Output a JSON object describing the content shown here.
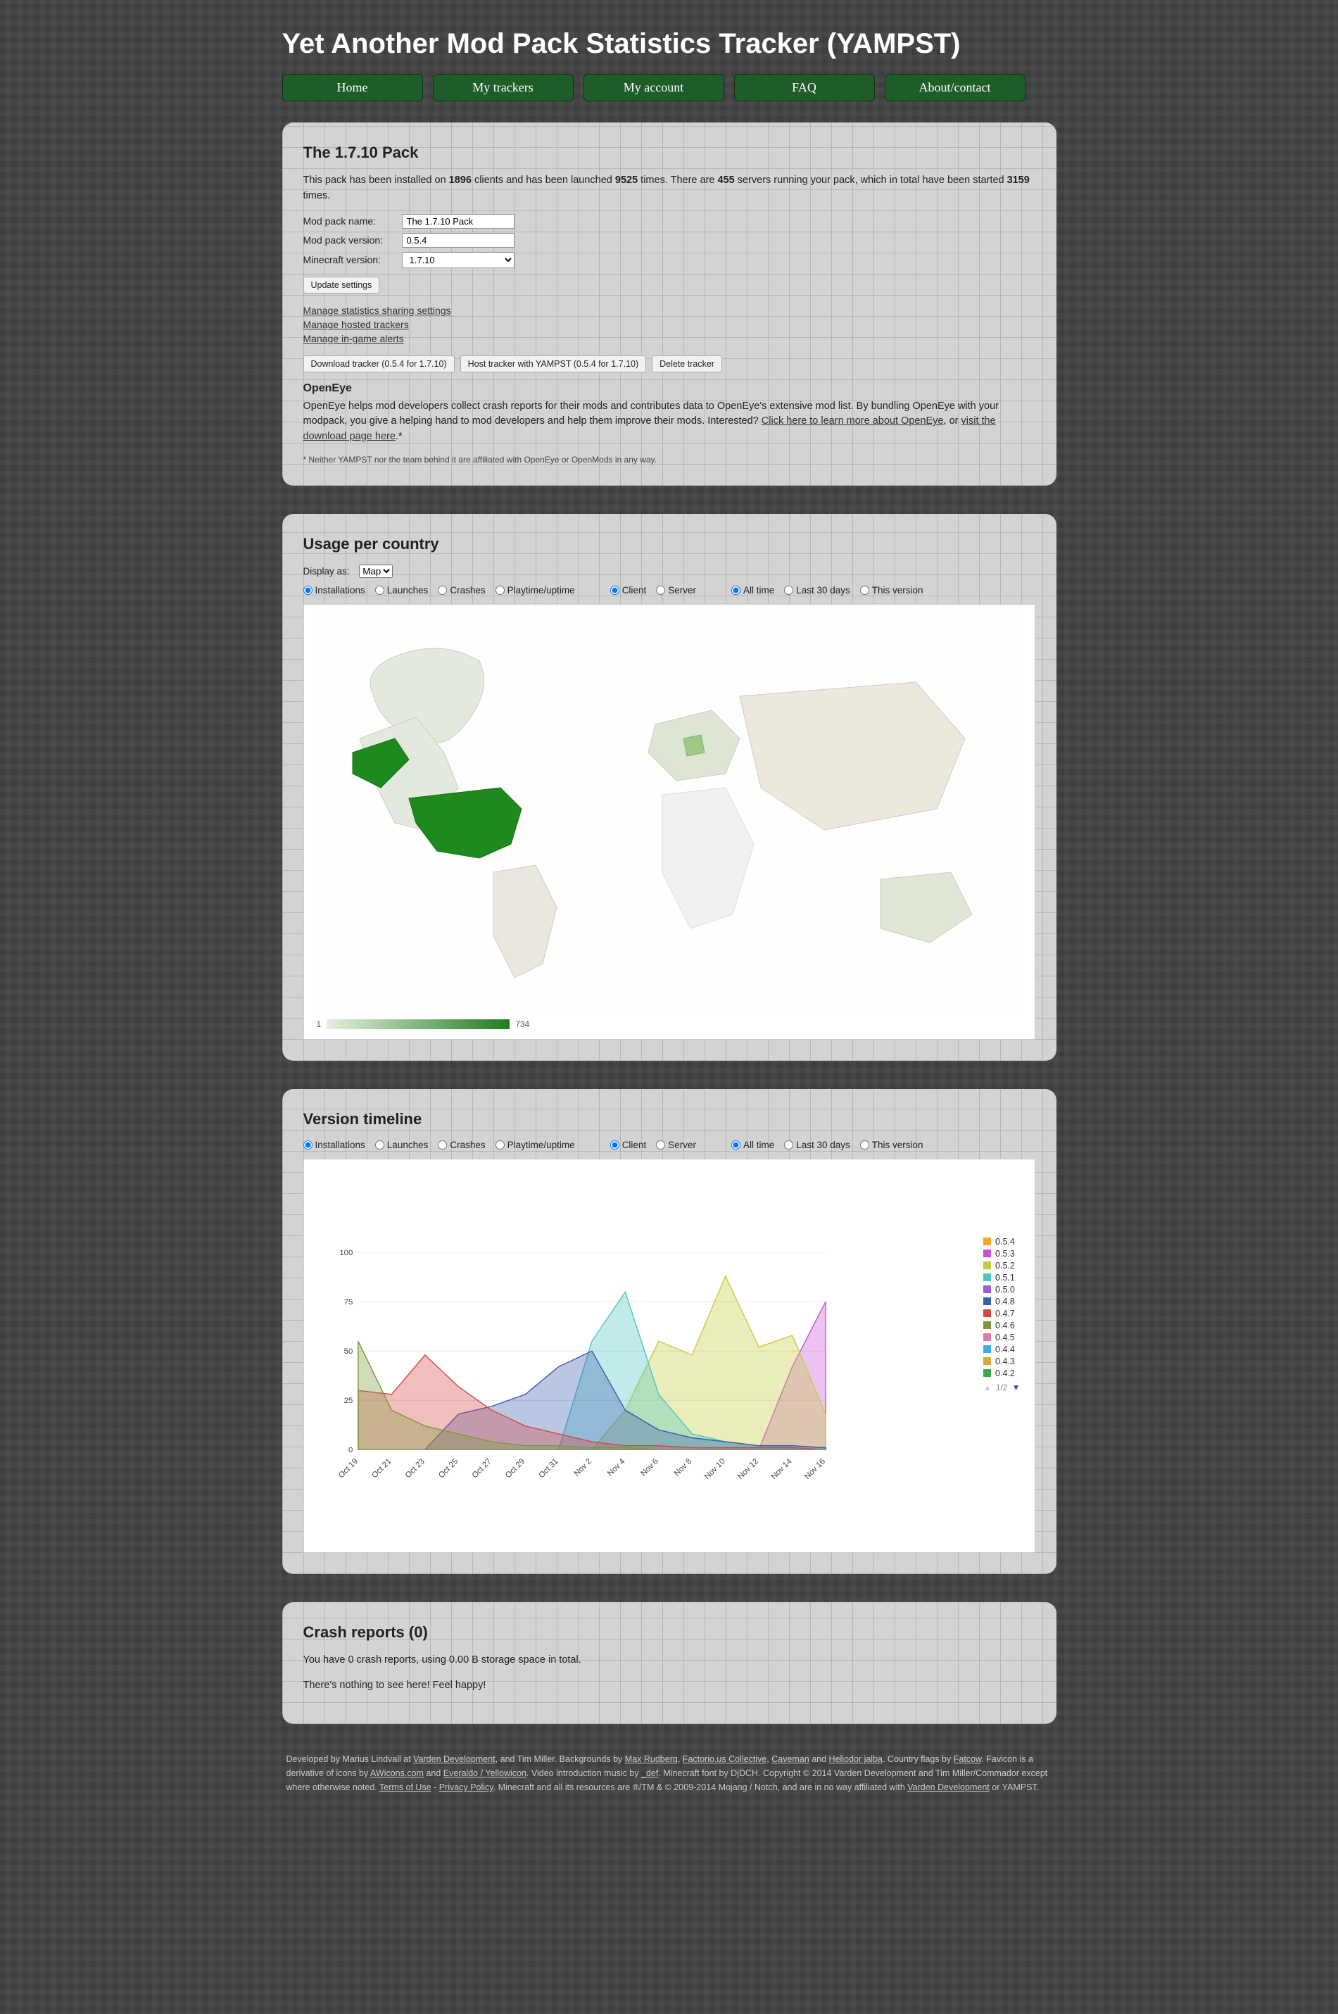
{
  "page_title": "Yet Another Mod Pack Statistics Tracker (YAMPST)",
  "nav": [
    "Home",
    "My trackers",
    "My account",
    "FAQ",
    "About/contact"
  ],
  "pack": {
    "title": "The 1.7.10 Pack",
    "stats": {
      "installs": "1896",
      "launches": "9525",
      "servers": "455",
      "server_starts": "3159"
    },
    "form": {
      "name_label": "Mod pack name:",
      "name_value": "The 1.7.10 Pack",
      "ver_label": "Mod pack version:",
      "ver_value": "0.5.4",
      "mc_label": "Minecraft version:",
      "mc_value": "1.7.10",
      "update_btn": "Update settings"
    },
    "links": {
      "share": "Manage statistics sharing settings",
      "hosted": "Manage hosted trackers",
      "alerts": "Manage in-game alerts"
    },
    "btns": {
      "download": "Download tracker (0.5.4 for 1.7.10)",
      "host": "Host tracker with YAMPST (0.5.4 for 1.7.10)",
      "delete": "Delete tracker"
    },
    "openeye": {
      "heading": "OpenEye",
      "text": "OpenEye helps mod developers collect crash reports for their mods and contributes data to OpenEye's extensive mod list. By bundling OpenEye with your modpack, you give a helping hand to mod developers and help them improve their mods. Interested? ",
      "link1": "Click here to learn more about OpenEye",
      "mid": ", or ",
      "link2": "visit the download page here",
      "end": ".*",
      "disclaimer": "* Neither YAMPST nor the team behind it are affiliated with OpenEye or OpenMods in any way."
    }
  },
  "usage": {
    "title": "Usage per country",
    "display_label": "Display as:",
    "display_value": "Map",
    "metric_opts": [
      "Installations",
      "Launches",
      "Crashes",
      "Playtime/uptime"
    ],
    "side_opts": [
      "Client",
      "Server"
    ],
    "time_opts": [
      "All time",
      "Last 30 days",
      "This version"
    ],
    "legend_min": "1",
    "legend_max": "734"
  },
  "timeline": {
    "title": "Version timeline",
    "metric_opts": [
      "Installations",
      "Launches",
      "Crashes",
      "Playtime/uptime"
    ],
    "side_opts": [
      "Client",
      "Server"
    ],
    "time_opts": [
      "All time",
      "Last 30 days",
      "This version"
    ],
    "pager": "1/2",
    "legend": [
      {
        "label": "0.5.4",
        "color": "#f5a623"
      },
      {
        "label": "0.5.3",
        "color": "#c94fd8"
      },
      {
        "label": "0.5.2",
        "color": "#c7cc3d"
      },
      {
        "label": "0.5.1",
        "color": "#4ec7c2"
      },
      {
        "label": "0.5.0",
        "color": "#a05cd8"
      },
      {
        "label": "0.4.8",
        "color": "#3d5db0"
      },
      {
        "label": "0.4.7",
        "color": "#d84545"
      },
      {
        "label": "0.4.6",
        "color": "#7a9a3a"
      },
      {
        "label": "0.4.5",
        "color": "#e07aa8"
      },
      {
        "label": "0.4.4",
        "color": "#3daee0"
      },
      {
        "label": "0.4.3",
        "color": "#d8a83a"
      },
      {
        "label": "0.4.2",
        "color": "#3aa845"
      }
    ]
  },
  "crash": {
    "title": "Crash reports (0)",
    "line1": "You have 0 crash reports, using 0.00 B storage space in total.",
    "line2": "There's nothing to see here! Feel happy!"
  },
  "footer": {
    "t1": "Developed by Marius Lindvall at ",
    "l1": "Varden Development",
    "t2": ", and Tim Miller. Backgrounds by ",
    "l2": "Max Rudberg",
    "t3": ", ",
    "l3": "Factorio.us Collective",
    "t4": ", ",
    "l4": "Caveman",
    "t5": " and ",
    "l5": "Heliodor jalba",
    "t6": ". Country flags by ",
    "l6": "Fatcow",
    "t7": ". Favicon is a derivative of icons by ",
    "l7": "AWicons.com",
    "t8": " and ",
    "l8": "Everaldo / Yellowicon",
    "t9": ". Video introduction music by ",
    "l9": "_def",
    "t10": ". Minecraft font by DjDCH. Copyright © 2014 Varden Development and Tim Miller/Commador except where otherwise noted. ",
    "l10": "Terms of Use",
    "t11": " - ",
    "l11": "Privacy Policy",
    "t12": ". Minecraft and all its resources are ®/TM & © 2009-2014 Mojang / Notch, and are in no way affiliated with ",
    "l12": "Varden Development",
    "t13": " or YAMPST."
  },
  "chart_data": {
    "type": "area",
    "title": "Version timeline",
    "xlabel": "",
    "ylabel": "",
    "y_ticks": [
      0,
      25,
      50,
      75,
      100
    ],
    "ylim": [
      0,
      105
    ],
    "x": [
      "Oct 19",
      "Oct 21",
      "Oct 23",
      "Oct 25",
      "Oct 27",
      "Oct 29",
      "Oct 31",
      "Nov 2",
      "Nov 4",
      "Nov 6",
      "Nov 8",
      "Nov 10",
      "Nov 12",
      "Nov 14",
      "Nov 16"
    ],
    "series": [
      {
        "name": "0.5.4",
        "color": "#f5a623",
        "values": [
          0,
          0,
          0,
          0,
          0,
          0,
          0,
          0,
          0,
          0,
          0,
          0,
          0,
          0,
          0
        ]
      },
      {
        "name": "0.5.3",
        "color": "#c94fd8",
        "values": [
          0,
          0,
          0,
          0,
          0,
          0,
          0,
          0,
          0,
          0,
          0,
          0,
          0,
          42,
          75
        ]
      },
      {
        "name": "0.5.2",
        "color": "#c7cc3d",
        "values": [
          0,
          0,
          0,
          0,
          0,
          0,
          0,
          0,
          20,
          55,
          48,
          88,
          52,
          58,
          18
        ]
      },
      {
        "name": "0.5.1",
        "color": "#4ec7c2",
        "values": [
          0,
          0,
          0,
          0,
          0,
          0,
          0,
          55,
          80,
          28,
          8,
          4,
          2,
          2,
          1
        ]
      },
      {
        "name": "0.5.0",
        "color": "#a05cd8",
        "values": [
          0,
          0,
          0,
          0,
          0,
          0,
          0,
          0,
          0,
          0,
          0,
          0,
          0,
          0,
          0
        ]
      },
      {
        "name": "0.4.8",
        "color": "#3d5db0",
        "values": [
          0,
          0,
          0,
          18,
          22,
          28,
          42,
          50,
          20,
          10,
          6,
          4,
          2,
          2,
          1
        ]
      },
      {
        "name": "0.4.7",
        "color": "#d84545",
        "values": [
          30,
          28,
          48,
          32,
          20,
          12,
          8,
          4,
          2,
          2,
          1,
          1,
          1,
          1,
          0
        ]
      },
      {
        "name": "0.4.6",
        "color": "#7a9a3a",
        "values": [
          55,
          20,
          12,
          8,
          4,
          2,
          2,
          1,
          1,
          0,
          0,
          0,
          0,
          0,
          0
        ]
      },
      {
        "name": "0.4.5",
        "color": "#e07aa8",
        "values": [
          0,
          0,
          0,
          0,
          0,
          0,
          0,
          0,
          0,
          0,
          0,
          0,
          0,
          0,
          0
        ]
      },
      {
        "name": "0.4.4",
        "color": "#3daee0",
        "values": [
          0,
          0,
          0,
          0,
          0,
          0,
          0,
          0,
          0,
          0,
          0,
          0,
          0,
          0,
          0
        ]
      },
      {
        "name": "0.4.3",
        "color": "#d8a83a",
        "values": [
          0,
          0,
          0,
          0,
          0,
          0,
          0,
          0,
          0,
          0,
          0,
          0,
          0,
          0,
          0
        ]
      },
      {
        "name": "0.4.2",
        "color": "#3aa845",
        "values": [
          0,
          0,
          0,
          0,
          0,
          0,
          0,
          0,
          0,
          0,
          0,
          0,
          0,
          0,
          0
        ]
      }
    ]
  }
}
